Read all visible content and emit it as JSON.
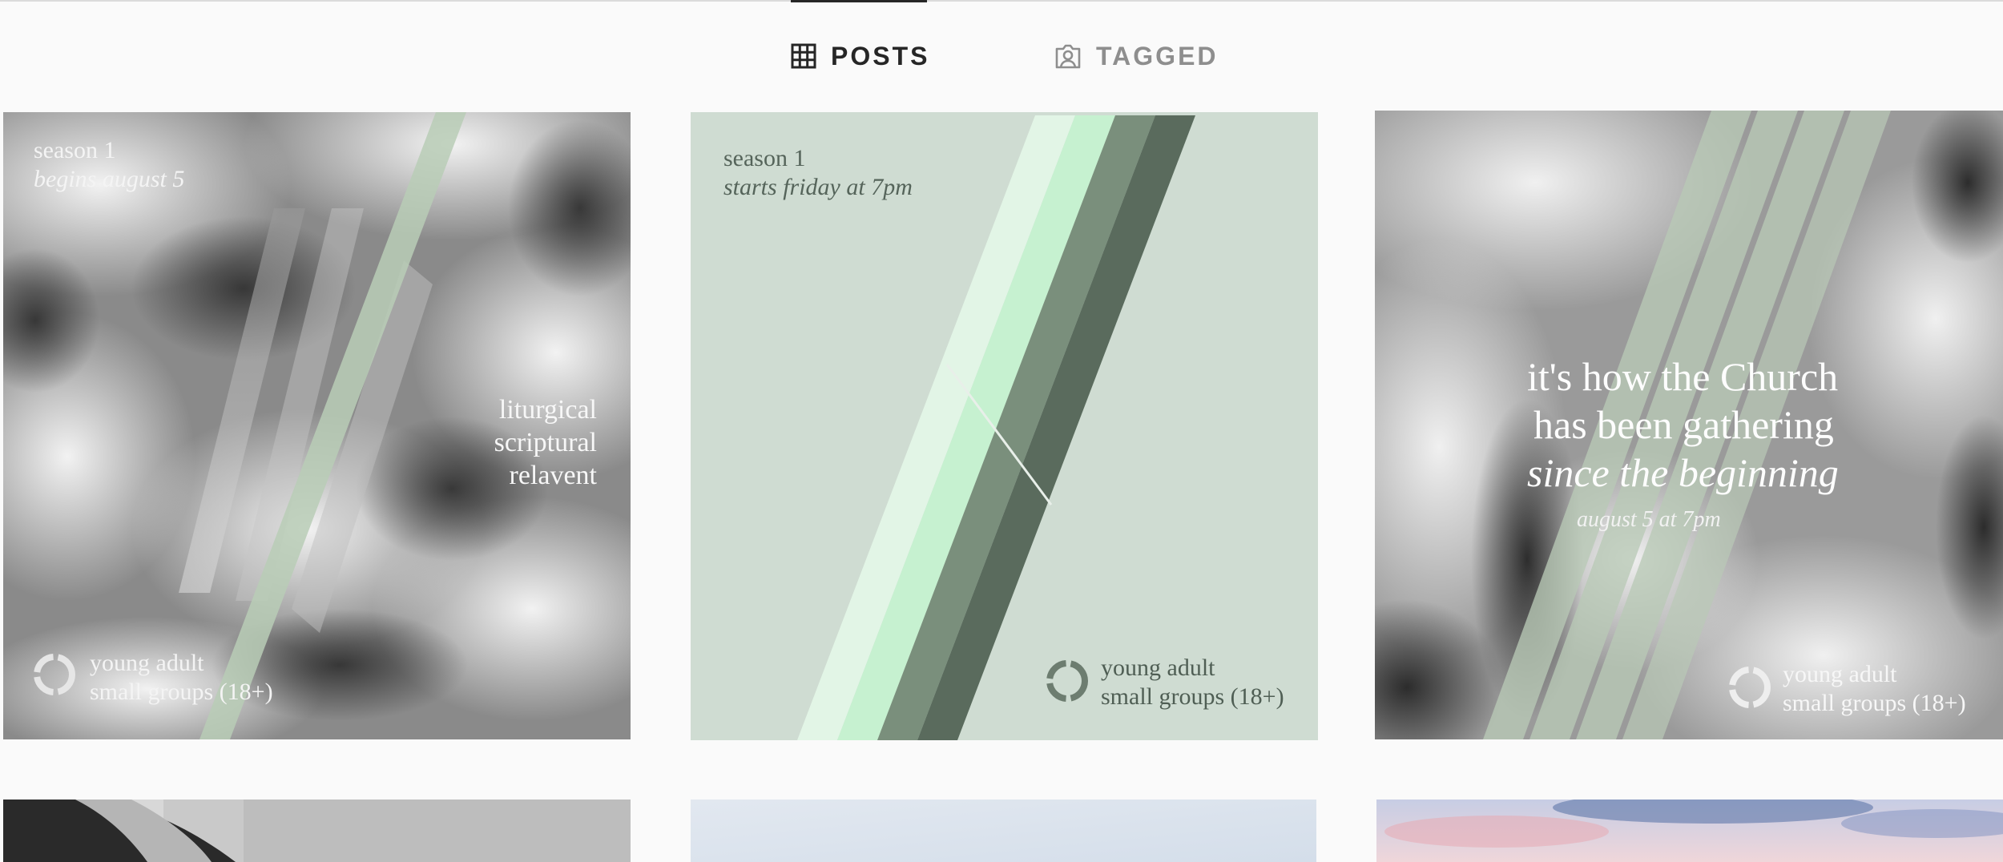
{
  "tabs": [
    {
      "label": "POSTS",
      "icon": "grid-icon",
      "active": true
    },
    {
      "label": "TAGGED",
      "icon": "tagged-person-icon",
      "active": false
    }
  ],
  "posts": [
    {
      "season": "season 1",
      "date": "begins august 5",
      "tagline": [
        "liturgical",
        "scriptural",
        "relavent"
      ],
      "brand": [
        "young adult",
        "small groups (18+)"
      ]
    },
    {
      "season": "season 1",
      "date": "starts friday at 7pm",
      "brand": [
        "young adult",
        "small groups (18+)"
      ]
    },
    {
      "headline": [
        "it's how the Church",
        "has been gathering",
        "since the beginning"
      ],
      "date": "august 5 at 7pm",
      "brand": [
        "young adult",
        "small groups (18+)"
      ]
    }
  ],
  "colors": {
    "active_tab": "#262626",
    "inactive_tab": "#8e8e8e",
    "sage": "#cfdcd2",
    "accent_green": "#c6f1d0"
  }
}
